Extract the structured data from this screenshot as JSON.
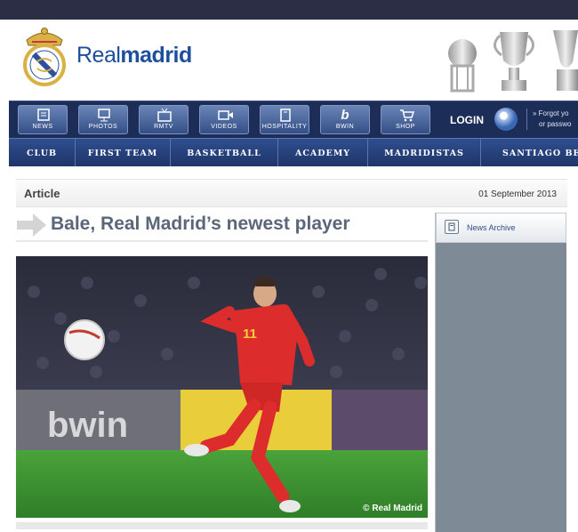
{
  "brand": {
    "name_part1": "Real",
    "name_part2": "madrid"
  },
  "toolbar": {
    "buttons": [
      {
        "label": "NEWS",
        "icon": "news-icon"
      },
      {
        "label": "PHOTOS",
        "icon": "photos-icon"
      },
      {
        "label": "RMTV",
        "icon": "tv-icon"
      },
      {
        "label": "VIDEOS",
        "icon": "videos-icon"
      },
      {
        "label": "HOSPITALITY",
        "icon": "hospitality-icon"
      },
      {
        "label": "BWIN",
        "icon": "bwin-icon",
        "glyph": "b"
      },
      {
        "label": "SHOP",
        "icon": "shop-cart-icon"
      }
    ],
    "login_label": "LOGIN",
    "forgot_line1": "» Forgot yo",
    "forgot_line2": "or passwo"
  },
  "nav": {
    "items": [
      "CLUB",
      "FIRST TEAM",
      "BASKETBALL",
      "ACADEMY",
      "MADRIDISTAS",
      "SANTIAGO BER"
    ]
  },
  "article": {
    "section_label": "Article",
    "date": "01 September 2013",
    "title": "Bale, Real Madrid’s newest player",
    "photo_credit": "© Real Madrid",
    "photo_banner_text": "bwin"
  },
  "sidebar": {
    "archive_label": "News Archive"
  },
  "colors": {
    "topbar": "#2b2e44",
    "toolbar": "#1c2d57",
    "nav": "#2f4e8f",
    "brand_blue": "#1d4f9c",
    "sidebar": "#7f8a97"
  }
}
